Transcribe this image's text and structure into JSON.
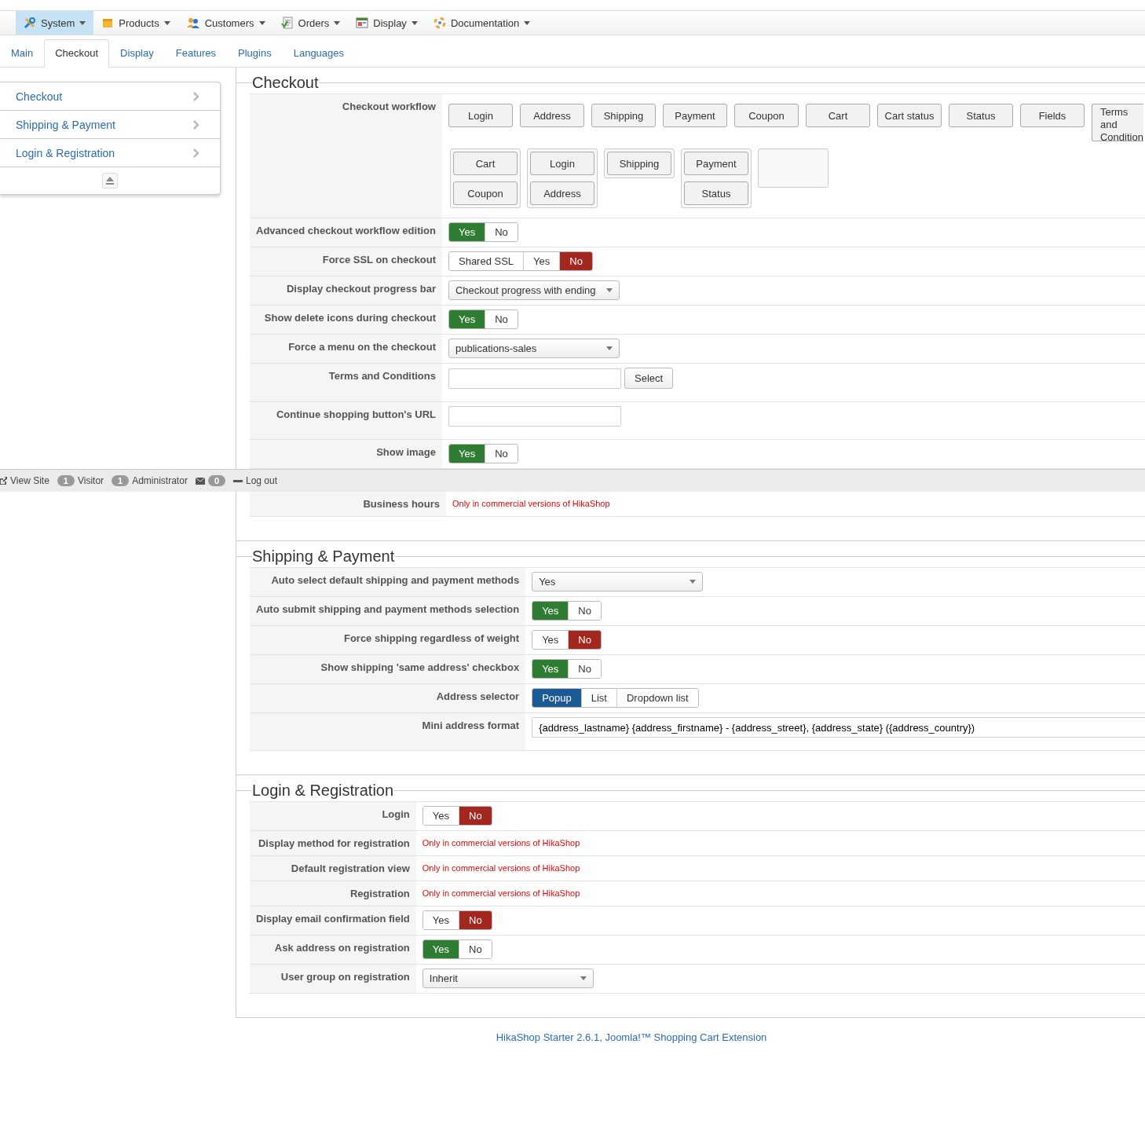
{
  "menu": [
    {
      "label": "System",
      "selected": true
    },
    {
      "label": "Products",
      "selected": false
    },
    {
      "label": "Customers",
      "selected": false
    },
    {
      "label": "Orders",
      "selected": false
    },
    {
      "label": "Display",
      "selected": false
    },
    {
      "label": "Documentation",
      "selected": false
    }
  ],
  "tabs": [
    {
      "label": "Main",
      "selected": false
    },
    {
      "label": "Checkout",
      "selected": true
    },
    {
      "label": "Display",
      "selected": false
    },
    {
      "label": "Features",
      "selected": false
    },
    {
      "label": "Plugins",
      "selected": false
    },
    {
      "label": "Languages",
      "selected": false
    }
  ],
  "sidebar": {
    "items": [
      {
        "label": "Checkout"
      },
      {
        "label": "Shipping & Payment"
      },
      {
        "label": "Login & Registration"
      }
    ]
  },
  "sections": [
    {
      "title": "Checkout",
      "rows": [
        {
          "label": "Checkout workflow",
          "kind": "workflow",
          "available": [
            "Login",
            "Address",
            "Shipping",
            "Payment",
            "Coupon",
            "Cart",
            "Cart status",
            "Status",
            "Fields",
            "Terms and Condition"
          ],
          "groups": [
            {
              "kind": "group",
              "items": [
                "Cart",
                "Coupon"
              ]
            },
            {
              "kind": "group",
              "items": [
                "Login",
                "Address"
              ]
            },
            {
              "kind": "group",
              "items": [
                "Shipping"
              ]
            },
            {
              "kind": "group",
              "items": [
                "Payment",
                "Status"
              ]
            },
            {
              "kind": "drop-zone"
            }
          ]
        },
        {
          "label": "Advanced checkout workflow edition",
          "kind": "toggle",
          "options": [
            {
              "label": "Yes",
              "kind": "positive",
              "selected": true
            },
            {
              "label": "No",
              "kind": "negative",
              "selected": false
            }
          ]
        },
        {
          "label": "Force SSL on checkout",
          "kind": "toggle",
          "options": [
            {
              "label": "Shared SSL",
              "kind": "neutral",
              "selected": false
            },
            {
              "label": "Yes",
              "kind": "positive",
              "selected": false
            },
            {
              "label": "No",
              "kind": "negative",
              "selected": true
            }
          ]
        },
        {
          "label": "Display checkout progress bar",
          "kind": "select",
          "value": "Checkout progress with ending"
        },
        {
          "label": "Show delete icons during checkout",
          "kind": "toggle",
          "options": [
            {
              "label": "Yes",
              "kind": "positive",
              "selected": true
            },
            {
              "label": "No",
              "kind": "negative",
              "selected": false
            }
          ]
        },
        {
          "label": "Force a menu on the checkout",
          "kind": "select",
          "value": "publications-sales"
        },
        {
          "label": "Terms and Conditions",
          "kind": "picker",
          "button": "Select"
        },
        {
          "label": "Continue shopping button's URL",
          "kind": "text"
        },
        {
          "label": "Show image",
          "kind": "toggle",
          "options": [
            {
              "label": "Yes",
              "kind": "positive",
              "selected": true
            },
            {
              "label": "No",
              "kind": "negative",
              "selected": false
            }
          ]
        },
        {
          "label": "Business hours",
          "kind": "note",
          "note": "Only in commercial versions of HikaShop"
        }
      ]
    },
    {
      "title": "Shipping & Payment",
      "rows": [
        {
          "label": "Auto select default shipping and payment methods",
          "kind": "select",
          "value": "Yes"
        },
        {
          "label": "Auto submit shipping and payment methods selection",
          "kind": "toggle",
          "options": [
            {
              "label": "Yes",
              "kind": "positive",
              "selected": true
            },
            {
              "label": "No",
              "kind": "negative",
              "selected": false
            }
          ]
        },
        {
          "label": "Force shipping regardless of weight",
          "kind": "toggle",
          "options": [
            {
              "label": "Yes",
              "kind": "positive",
              "selected": false
            },
            {
              "label": "No",
              "kind": "negative",
              "selected": true
            }
          ]
        },
        {
          "label": "Show shipping 'same address' checkbox",
          "kind": "toggle",
          "options": [
            {
              "label": "Yes",
              "kind": "positive",
              "selected": true
            },
            {
              "label": "No",
              "kind": "negative",
              "selected": false
            }
          ]
        },
        {
          "label": "Address selector",
          "kind": "toggle",
          "options": [
            {
              "label": "Popup",
              "kind": "neutral",
              "selected": true
            },
            {
              "label": "List",
              "kind": "neutral",
              "selected": false
            },
            {
              "label": "Dropdown list",
              "kind": "neutral",
              "selected": false
            }
          ]
        },
        {
          "label": "Mini address format",
          "kind": "wide-text",
          "value": "{address_lastname} {address_firstname} - {address_street}, {address_state} ({address_country})"
        }
      ]
    },
    {
      "title": "Login & Registration",
      "rows": [
        {
          "label": "Login",
          "kind": "toggle",
          "options": [
            {
              "label": "Yes",
              "kind": "positive",
              "selected": false
            },
            {
              "label": "No",
              "kind": "negative",
              "selected": true
            }
          ]
        },
        {
          "label": "Display method for registration",
          "kind": "note",
          "note": "Only in commercial versions of HikaShop"
        },
        {
          "label": "Default registration view",
          "kind": "note",
          "note": "Only in commercial versions of HikaShop"
        },
        {
          "label": "Registration",
          "kind": "note",
          "note": "Only in commercial versions of HikaShop"
        },
        {
          "label": "Display email confirmation field",
          "kind": "toggle",
          "options": [
            {
              "label": "Yes",
              "kind": "positive",
              "selected": false
            },
            {
              "label": "No",
              "kind": "negative",
              "selected": true
            }
          ]
        },
        {
          "label": "Ask address on registration",
          "kind": "toggle",
          "options": [
            {
              "label": "Yes",
              "kind": "positive",
              "selected": true
            },
            {
              "label": "No",
              "kind": "negative",
              "selected": false
            }
          ]
        },
        {
          "label": "User group on registration",
          "kind": "select",
          "value": "Inherit"
        }
      ]
    }
  ],
  "status_bar": {
    "items": [
      {
        "kind": "link",
        "label": "View Site"
      },
      {
        "kind": "count",
        "count": "1",
        "label": "Visitor"
      },
      {
        "kind": "count",
        "count": "1",
        "label": "Administrator"
      },
      {
        "kind": "messages",
        "count": "0"
      },
      {
        "kind": "logout",
        "label": "Log out"
      }
    ]
  },
  "footer": "HikaShop Starter 2.6.1, Joomla!™ Shopping Cart Extension"
}
